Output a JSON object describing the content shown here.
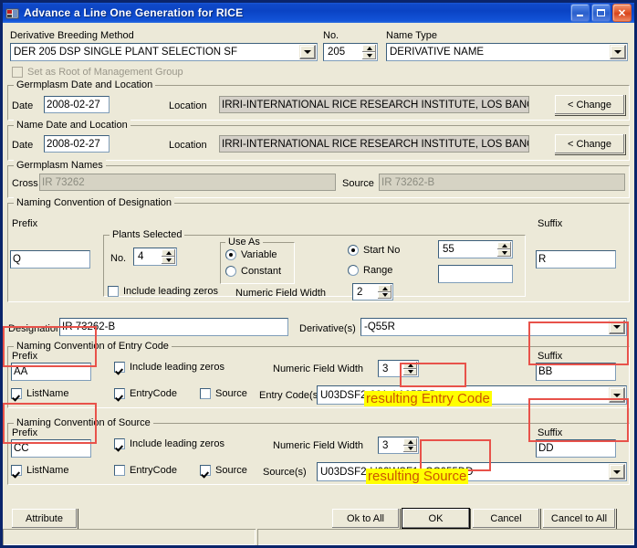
{
  "window": {
    "title": "Advance a Line One Generation for RICE",
    "icon": "app-icon",
    "minimize": "minimize-icon",
    "maximize": "maximize-icon",
    "close": "close-icon"
  },
  "top": {
    "method_label": "Derivative Breeding Method",
    "method_value": "DER  205 DSP SINGLE PLANT SELECTION SF",
    "no_label": "No.",
    "no_value": "205",
    "nametype_label": "Name Type",
    "nametype_value": "DERIVATIVE NAME",
    "set_root_label": "Set as Root of Management Group"
  },
  "germplasm_date": {
    "group_title": "Germplasm Date and Location",
    "date_label": "Date",
    "date_value": "2008-02-27",
    "location_label": "Location",
    "location_value": "IRRI-INTERNATIONAL RICE RESEARCH INSTITUTE, LOS BANOS",
    "change_label": "< Change"
  },
  "name_date": {
    "group_title": "Name Date and Location",
    "date_label": "Date",
    "date_value": "2008-02-27",
    "location_label": "Location",
    "location_value": "IRRI-INTERNATIONAL RICE RESEARCH INSTITUTE, LOS BANOS",
    "change_label": "< Change"
  },
  "germplasm_names": {
    "group_title": "Germplasm Names",
    "cross_label": "Cross",
    "cross_value": "IR 73262",
    "source_label": "Source",
    "source_value": "IR 73262-B"
  },
  "designation": {
    "group_title": "Naming Convention of Designation",
    "prefix_label": "Prefix",
    "prefix_value": "Q",
    "plants_group_title": "Plants Selected",
    "no_label": "No.",
    "no_value": "4",
    "use_as_title": "Use As",
    "variable_label": "Variable",
    "constant_label": "Constant",
    "use_as_selected": "Variable",
    "include_leading_zeros_label": "Include leading zeros",
    "include_leading_zeros_checked": false,
    "numeric_field_width_label": "Numeric Field Width",
    "numeric_field_width_value": "2",
    "start_no_label": "Start No",
    "start_no_value": "55",
    "range_label": "Range",
    "range_value": "",
    "mode_selected": "Start No",
    "suffix_label": "Suffix",
    "suffix_value": "R"
  },
  "designation_row": {
    "designation_label": "Designation",
    "designation_value": "IR 73262-B",
    "derivatives_label": "Derivative(s)",
    "derivatives_value": "-Q55R"
  },
  "entry_code": {
    "group_title": "Naming Convention of Entry Code",
    "prefix_label": "Prefix",
    "prefix_value": "AA",
    "include_leading_zeros_label": "Include leading zeros",
    "include_leading_zeros_checked": true,
    "numeric_field_width_label": "Numeric Field Width",
    "numeric_field_width_value": "3",
    "suffix_label": "Suffix",
    "suffix_value": "BB",
    "listname_label": "ListName",
    "listname_checked": true,
    "entrycode_label": "EntryCode",
    "entrycode_checked": true,
    "source_label": "Source",
    "source_checked": false,
    "entry_codes_label": "Entry Code(s)",
    "entry_codes_value": "U03DSF2-001-AA055BB"
  },
  "source_conv": {
    "group_title": "Naming Convention of Source",
    "prefix_label": "Prefix",
    "prefix_value": "CC",
    "include_leading_zeros_label": "Include leading zeros",
    "include_leading_zeros_checked": true,
    "numeric_field_width_label": "Numeric Field Width",
    "numeric_field_width_value": "3",
    "suffix_label": "Suffix",
    "suffix_value": "DD",
    "listname_label": "ListName",
    "listname_checked": true,
    "entrycode_label": "EntryCode",
    "entrycode_checked": false,
    "source_label": "Source",
    "source_checked": true,
    "sources_label": "Source(s)",
    "sources_value": "U03DSF2-U02WSF1--CC055DD"
  },
  "footer": {
    "attribute_label": "Attribute",
    "ok_to_all_label": "Ok to All",
    "ok_label": "OK",
    "cancel_label": "Cancel",
    "cancel_to_all_label": "Cancel to All"
  },
  "annotations": {
    "entry_code_note": "resulting Entry Code",
    "source_note": "resulting Source",
    "highlight_color": "#ffff00",
    "note_text_color": "#cc5500",
    "box_color": "#e8524a"
  }
}
